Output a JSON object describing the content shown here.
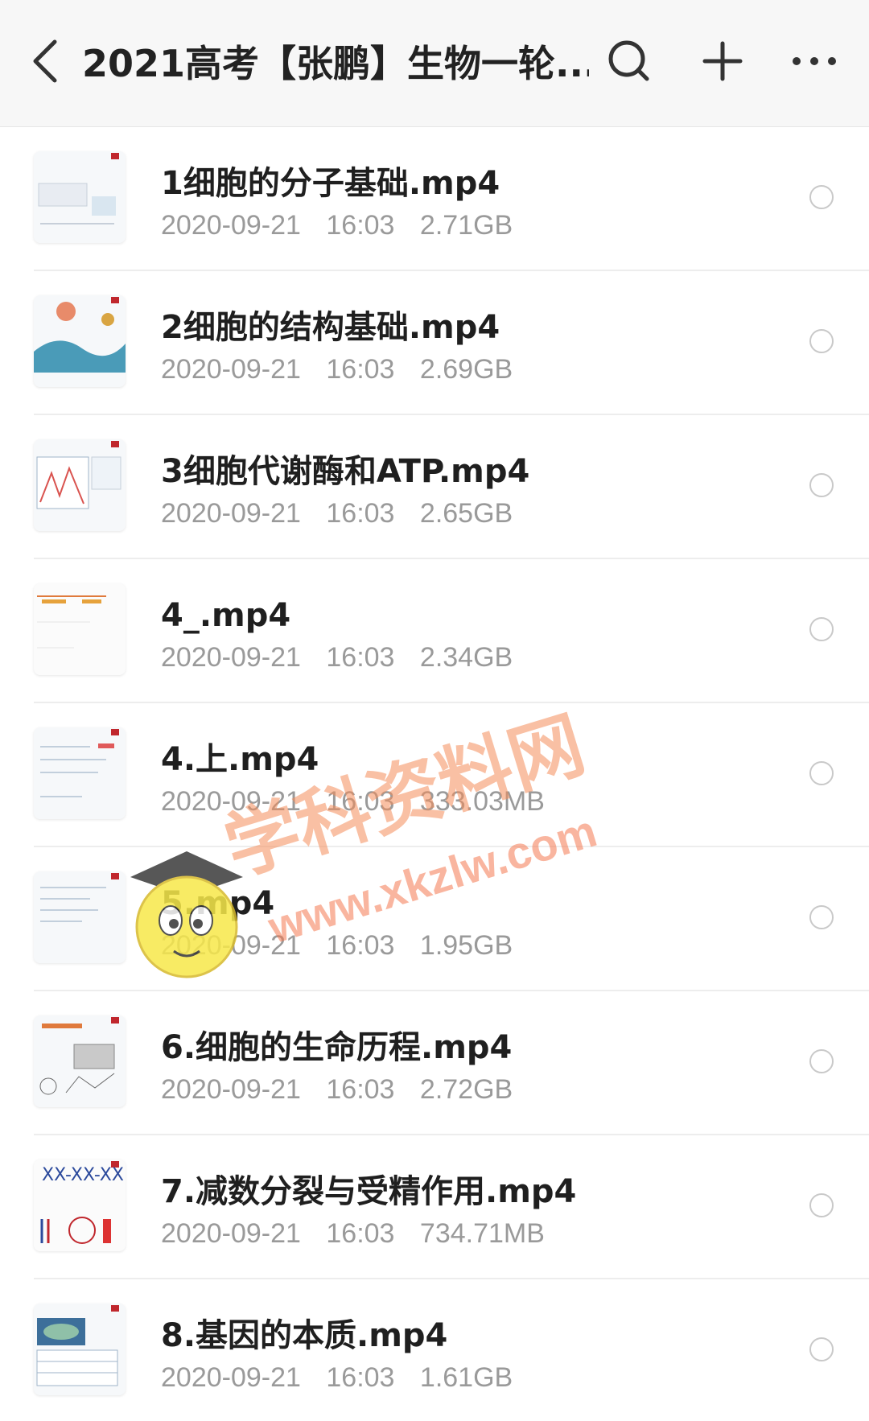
{
  "header": {
    "title": "2021高考【张鹏】生物一轮...",
    "back_icon": "chevron-left-icon",
    "search_icon": "search-icon",
    "add_icon": "plus-icon",
    "more_icon": "more-horizontal-icon"
  },
  "files": [
    {
      "name": "1细胞的分子基础.mp4",
      "date": "2020-09-21",
      "time": "16:03",
      "size": "2.71GB"
    },
    {
      "name": "2细胞的结构基础.mp4",
      "date": "2020-09-21",
      "time": "16:03",
      "size": "2.69GB"
    },
    {
      "name": "3细胞代谢酶和ATP.mp4",
      "date": "2020-09-21",
      "time": "16:03",
      "size": "2.65GB"
    },
    {
      "name": "4_.mp4",
      "date": "2020-09-21",
      "time": "16:03",
      "size": "2.34GB"
    },
    {
      "name": "4.上.mp4",
      "date": "2020-09-21",
      "time": "16:03",
      "size": "333.03MB"
    },
    {
      "name": "5.mp4",
      "date": "2020-09-21",
      "time": "16:03",
      "size": "1.95GB"
    },
    {
      "name": "6.细胞的生命历程.mp4",
      "date": "2020-09-21",
      "time": "16:03",
      "size": "2.72GB"
    },
    {
      "name": "7.减数分裂与受精作用.mp4",
      "date": "2020-09-21",
      "time": "16:03",
      "size": "734.71MB"
    },
    {
      "name": "8.基因的本质.mp4",
      "date": "2020-09-21",
      "time": "16:03",
      "size": "1.61GB"
    }
  ],
  "watermark": {
    "text": "学科资料网",
    "url": "www.xkzlw.com"
  }
}
